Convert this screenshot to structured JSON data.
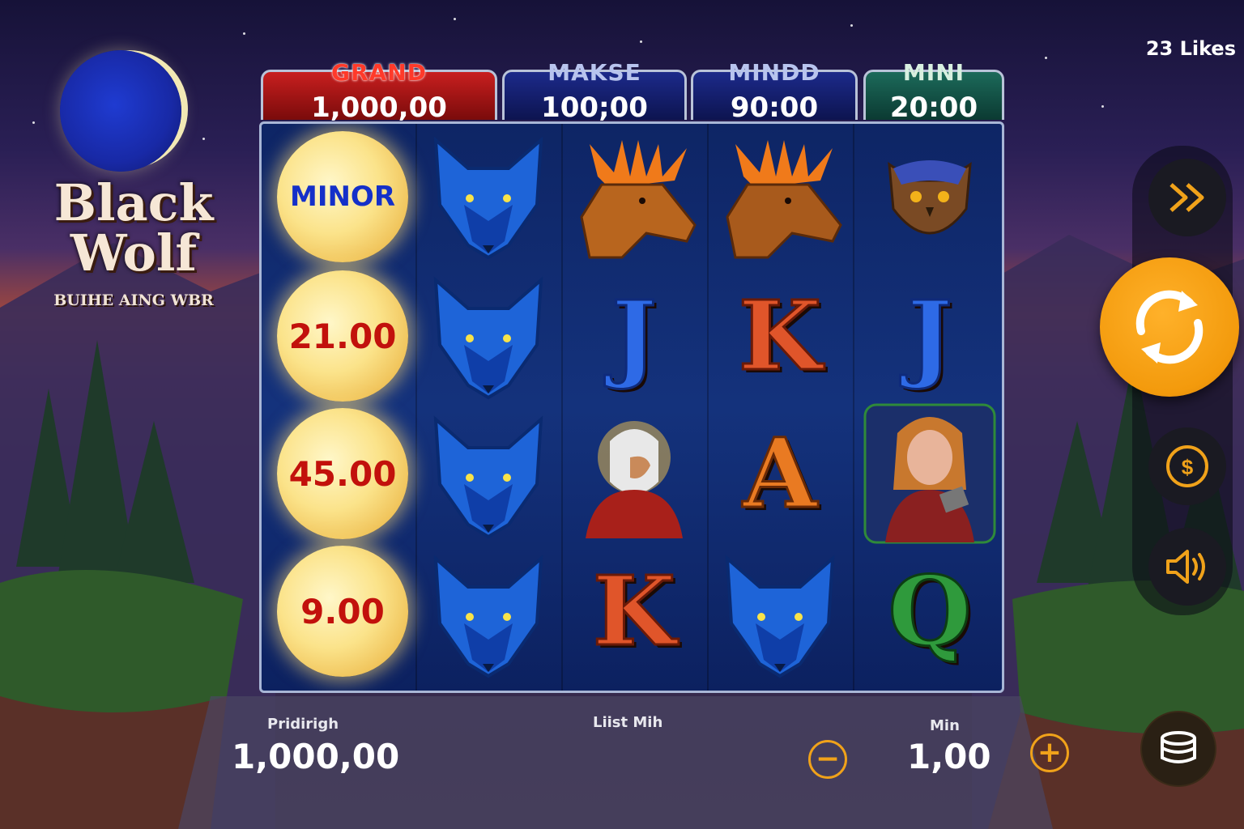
{
  "logo": {
    "title_line1": "Black",
    "title_line2": "Wolf",
    "subtitle": "BUIHE AING WBR"
  },
  "likes": "23 Likes",
  "jackpots": [
    {
      "label": "GRAND",
      "value": "1,000,00"
    },
    {
      "label": "MAKSE",
      "value": "100;00"
    },
    {
      "label": "MINDD",
      "value": "90:00"
    },
    {
      "label": "MINI",
      "value": "20:00"
    }
  ],
  "reels": {
    "orbs": [
      "MINOR",
      "21.00",
      "45.00",
      "9.00"
    ],
    "column2": [
      "wolf",
      "wolf",
      "wolf",
      "wolf"
    ],
    "column3": [
      "moose",
      "J",
      "old-man",
      "K"
    ],
    "column4": [
      "moose",
      "K",
      "A",
      "wolf"
    ],
    "column5": [
      "owl",
      "J",
      "woman",
      "Q"
    ]
  },
  "bottom": {
    "balance_label": "Pridirigh",
    "balance_value": "1,000,00",
    "center_label": "Liist Mih",
    "bet_label": "Min",
    "bet_value": "1,00",
    "minus": "−",
    "plus": "+"
  },
  "colors": {
    "accent": "#f39a0c",
    "grand": "#c81f1f",
    "reel_bg": "#14327c"
  }
}
